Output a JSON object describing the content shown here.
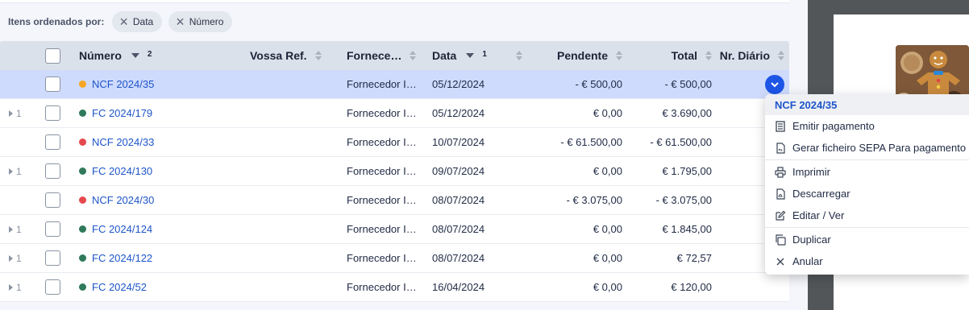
{
  "sortbar": {
    "label": "Itens ordenados por:",
    "chips": [
      {
        "label": "Data"
      },
      {
        "label": "Número"
      }
    ]
  },
  "table": {
    "columns": {
      "numero": "Número",
      "numero_order": "2",
      "vossa_ref": "Vossa Ref.",
      "fornecedor": "Fornece…",
      "data": "Data",
      "data_order": "1",
      "pendente": "Pendente",
      "total": "Total",
      "nr_diario": "Nr. Diário"
    },
    "rows": [
      {
        "expand": "",
        "numero": "NCF 2024/35",
        "status": "pending",
        "fornecedor": "Fornecedor I…",
        "data": "05/12/2024",
        "pendente": "- € 500,00",
        "total": "- € 500,00"
      },
      {
        "expand": "1",
        "numero": "FC 2024/179",
        "status": "paid",
        "fornecedor": "Fornecedor I…",
        "data": "05/12/2024",
        "pendente": "€ 0,00",
        "total": "€ 3.690,00"
      },
      {
        "expand": "",
        "numero": "NCF 2024/33",
        "status": "overdue",
        "fornecedor": "Fornecedor I…",
        "data": "10/07/2024",
        "pendente": "- € 61.500,00",
        "total": "- € 61.500,00"
      },
      {
        "expand": "1",
        "numero": "FC 2024/130",
        "status": "paid",
        "fornecedor": "Fornecedor I…",
        "data": "09/07/2024",
        "pendente": "€ 0,00",
        "total": "€ 1.795,00"
      },
      {
        "expand": "",
        "numero": "NCF 2024/30",
        "status": "overdue",
        "fornecedor": "Fornecedor I…",
        "data": "08/07/2024",
        "pendente": "- € 3.075,00",
        "total": "- € 3.075,00"
      },
      {
        "expand": "1",
        "numero": "FC 2024/124",
        "status": "paid",
        "fornecedor": "Fornecedor I…",
        "data": "08/07/2024",
        "pendente": "€ 0,00",
        "total": "€ 1.845,00"
      },
      {
        "expand": "1",
        "numero": "FC 2024/122",
        "status": "paid",
        "fornecedor": "Fornecedor I…",
        "data": "08/07/2024",
        "pendente": "€ 0,00",
        "total": "€ 72,57"
      },
      {
        "expand": "1",
        "numero": "FC 2024/52",
        "status": "paid",
        "fornecedor": "Fornecedor I…",
        "data": "16/04/2024",
        "pendente": "€ 0,00",
        "total": "€ 120,00"
      }
    ],
    "status_colors": {
      "pending": "#f5a623",
      "paid": "#2f7a5a",
      "overdue": "#e5484d"
    }
  },
  "context_menu": {
    "title": "NCF 2024/35",
    "items": [
      {
        "label": "Emitir pagamento",
        "icon": "receipt-icon"
      },
      {
        "label": "Gerar ficheiro SEPA Para pagamento",
        "icon": "xml-file-icon"
      },
      {
        "label": "Imprimir",
        "icon": "printer-icon"
      },
      {
        "label": "Descarregar",
        "icon": "pdf-file-icon"
      },
      {
        "label": "Editar / Ver",
        "icon": "edit-icon"
      },
      {
        "label": "Duplicar",
        "icon": "copy-icon"
      },
      {
        "label": "Anular",
        "icon": "close-icon"
      }
    ]
  },
  "colors": {
    "accent": "#1d55e6",
    "link": "#1d55c9",
    "selected_row": "#cfdbfd"
  }
}
